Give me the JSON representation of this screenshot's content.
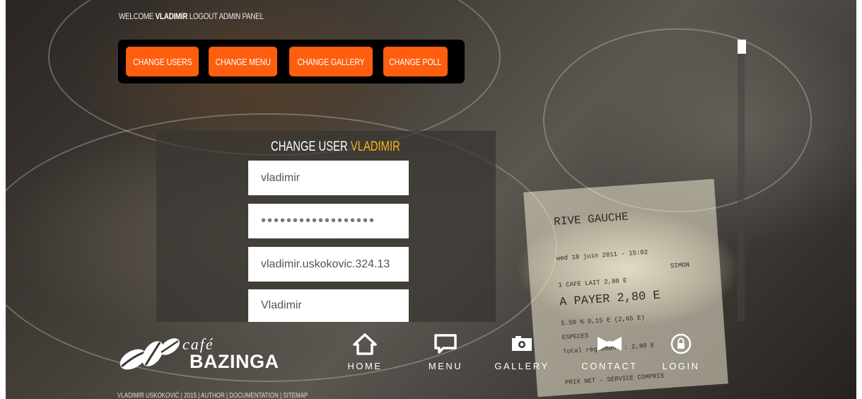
{
  "welcome": {
    "prefix": "WELCOME",
    "username": "VLADIMIR",
    "logout": "LOGOUT",
    "admin_panel": "ADMIN PANEL"
  },
  "admin_bar": {
    "buttons": [
      "CHANGE USERS",
      "CHANGE MENU",
      "CHANGE GALLERY",
      "CHANGE POLL"
    ]
  },
  "form": {
    "title_prefix": "CHANGE USER",
    "title_user": "VLADIMIR",
    "username_value": "vladimir",
    "password_value": "••••••••••••••••••",
    "email_value": "vladimir.uskokovic.324.13",
    "name_value": "Vladimir"
  },
  "logo": {
    "cafe": "café",
    "brand": "BAZINGA"
  },
  "nav": {
    "items": [
      {
        "label": "HOME",
        "icon": "home-icon"
      },
      {
        "label": "MENU",
        "icon": "chat-icon"
      },
      {
        "label": "GALLERY",
        "icon": "camera-icon"
      },
      {
        "label": "CONTACT",
        "icon": "bowtie-icon"
      },
      {
        "label": "LOGIN",
        "icon": "lock-icon"
      }
    ]
  },
  "footer": {
    "text": "VLADIMIR USKOKOVIĆ | 2015 | AUTHOR | DOCUMENTATION | SITEMAP"
  },
  "receipt": {
    "lines": [
      "RIVE GAUCHE",
      "wed 18 juin 2011 - 15:02",
      "SIMON",
      "1 CAFE LAIT   2,80 E",
      "A PAYER   2,80 E",
      "5.50 %   0,15 E   (2,65 E)",
      "ESPECES",
      "Total règlement : 2,80 E",
      "PRIX NET - SERVICE COMPRIS"
    ]
  },
  "colors": {
    "accent": "#ff5e0e",
    "highlight": "#ffb21a"
  }
}
